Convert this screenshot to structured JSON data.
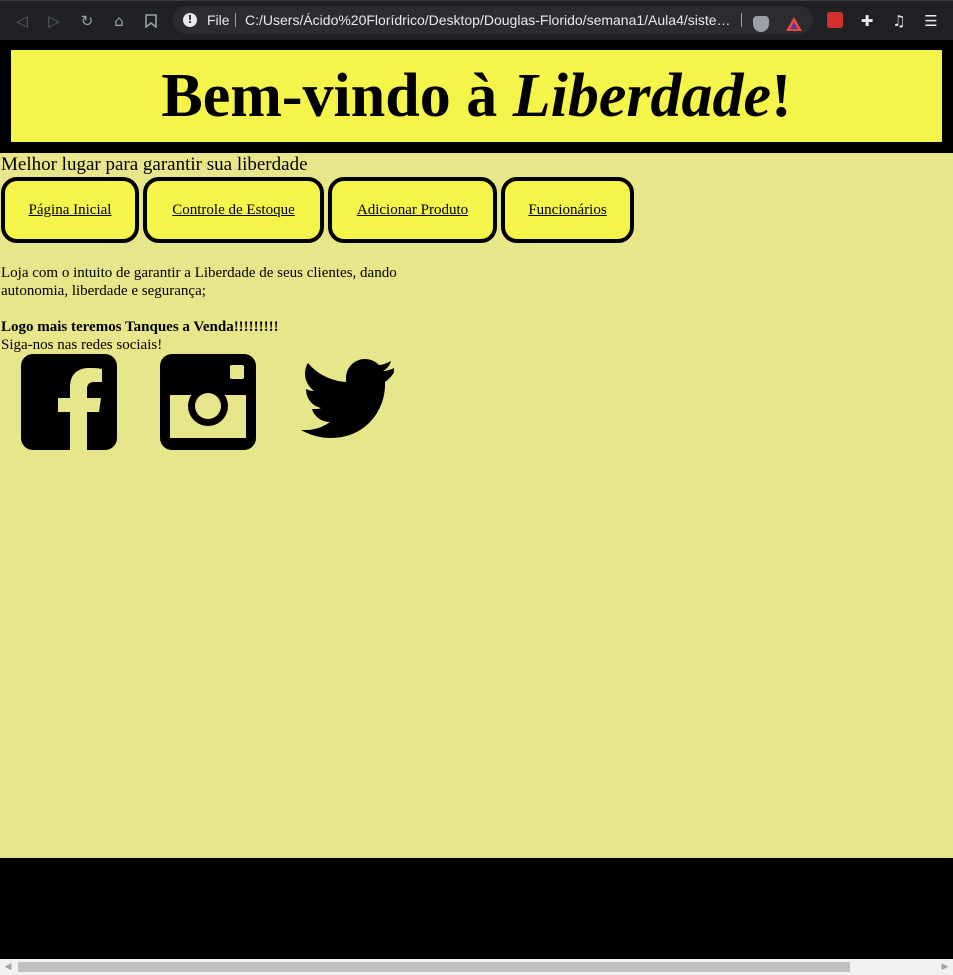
{
  "browser": {
    "file_label": "File",
    "url": "C:/Users/Ácido%20Florídrico/Desktop/Douglas-Florido/semana1/Aula4/sistema/index.html",
    "icons": [
      "back-icon",
      "forward-icon",
      "reload-icon",
      "home-icon",
      "bookmark-icon",
      "info-icon",
      "brave-shield-icon",
      "brave-rewards-icon",
      "extension-icon",
      "puzzle-icon",
      "media-icon",
      "menu-icon"
    ]
  },
  "header": {
    "title_prefix": "Bem-vindo à ",
    "title_emph": "Liberdade",
    "title_suffix": "!"
  },
  "tagline": "Melhor lugar para garantir sua liberdade",
  "nav": [
    {
      "label": "Página Inicial"
    },
    {
      "label": "Controle de Estoque"
    },
    {
      "label": "Adicionar Produto"
    },
    {
      "label": "Funcionários"
    }
  ],
  "description": "Loja com o intuito de garantir a Liberdade de seus clientes, dando autonomia, liberdade e segurança;",
  "promo": "Logo mais teremos Tanques a Venda!!!!!!!!!",
  "follow": "Siga-nos nas redes sociais!",
  "colors": {
    "header_bg": "#f5f44a",
    "content_bg": "#e7e68b",
    "frame": "#000000"
  },
  "social": [
    "facebook-icon",
    "instagram-icon",
    "twitter-icon"
  ]
}
